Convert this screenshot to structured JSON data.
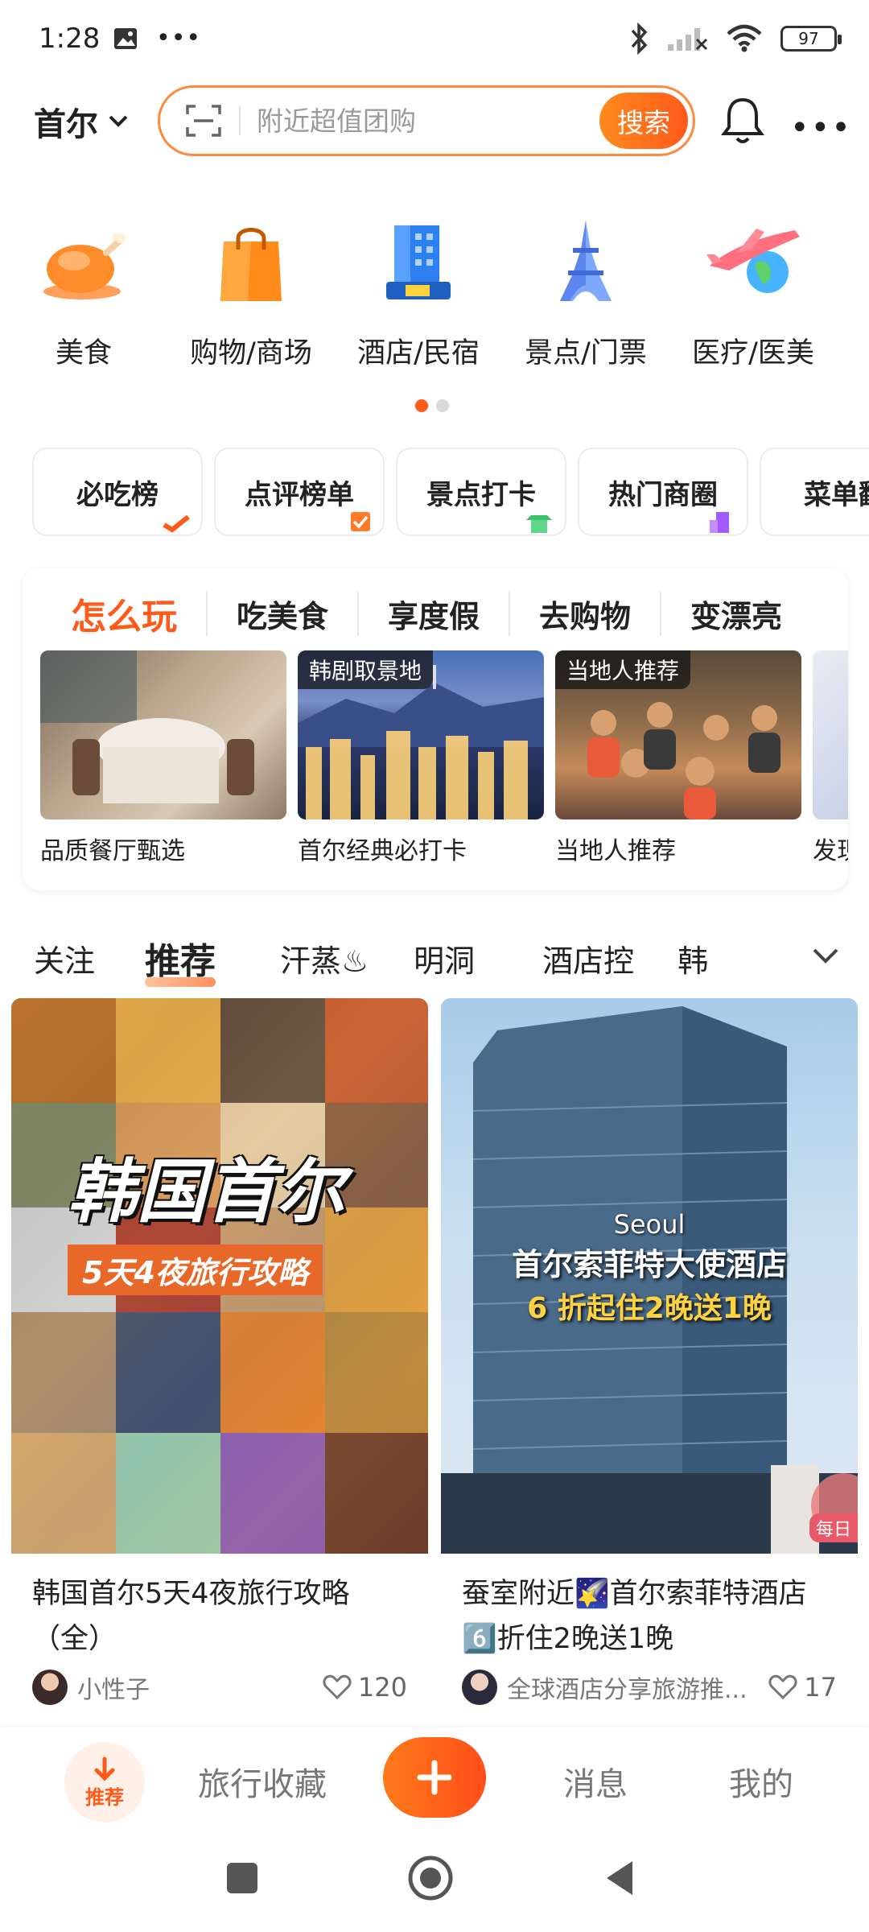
{
  "status_bar": {
    "time": "1:28",
    "battery": "97"
  },
  "header": {
    "city": "首尔",
    "search_placeholder": "附近超值团购",
    "search_button": "搜索"
  },
  "categories": [
    {
      "label": "美食",
      "icon": "roast-chicken-icon"
    },
    {
      "label": "购物/商场",
      "icon": "shopping-bag-icon"
    },
    {
      "label": "酒店/民宿",
      "icon": "hotel-building-icon"
    },
    {
      "label": "景点/门票",
      "icon": "eiffel-tower-icon"
    },
    {
      "label": "医疗/医美",
      "icon": "airplane-globe-icon"
    }
  ],
  "rank_chips": [
    "必吃榜",
    "点评榜单",
    "景点打卡",
    "热门商圈",
    "菜单翻"
  ],
  "play": {
    "tabs": [
      "怎么玩",
      "吃美食",
      "享度假",
      "去购物",
      "变漂亮"
    ],
    "items": [
      {
        "caption": "品质餐厅甄选",
        "tag": ""
      },
      {
        "caption": "首尔经典必打卡",
        "tag": "韩剧取景地"
      },
      {
        "caption": "当地人推荐",
        "tag": "当地人推荐"
      },
      {
        "caption": "发现",
        "tag": ""
      }
    ]
  },
  "feed_tabs": [
    "关注",
    "推荐",
    "汗蒸♨",
    "明洞",
    "酒店控",
    "韩"
  ],
  "feed": [
    {
      "title": "韩国首尔5天4夜旅行攻略（全）",
      "image_title": "韩国首尔",
      "image_subtitle": "5天4夜旅行攻略",
      "author": "小性子",
      "likes": "120"
    },
    {
      "title": "蚕室附近🌠首尔索菲特酒店6️⃣折住2晚送1晚",
      "image_en": "Seoul",
      "image_title": "首尔索菲特大使酒店",
      "image_subtitle": "6 折起住2晚送1晚",
      "image_badge": "每日",
      "author": "全球酒店分享旅游推...",
      "likes": "17"
    }
  ],
  "bottom_nav": {
    "home": "推荐",
    "collect": "旅行收藏",
    "messages": "消息",
    "mine": "我的"
  },
  "colors": {
    "accent": "#ff5a1a",
    "accent_light": "#ff8a3d"
  }
}
